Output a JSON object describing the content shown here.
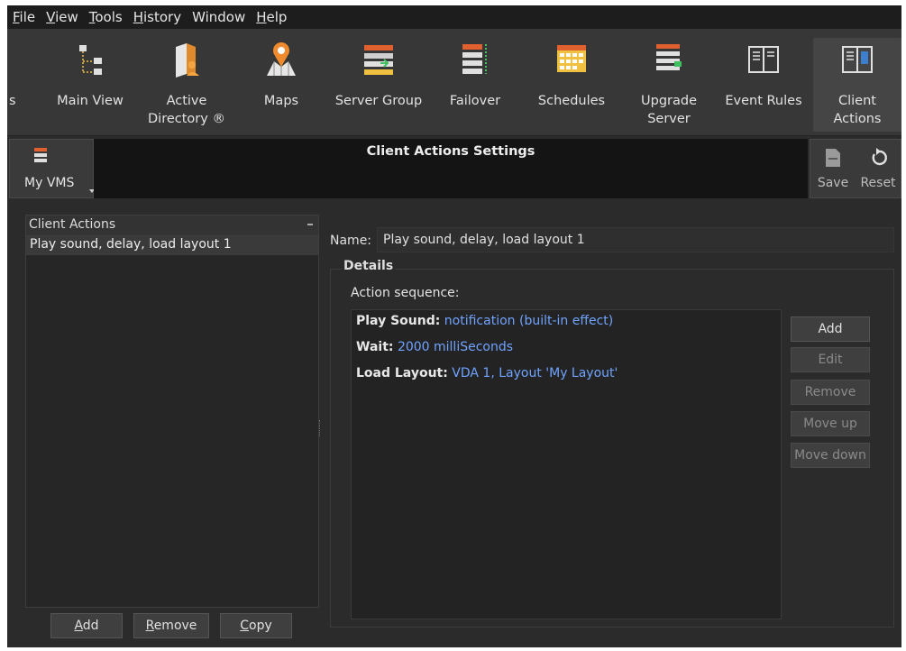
{
  "menu": [
    {
      "label": "File",
      "ul": "F",
      "rest": "ile"
    },
    {
      "label": "View",
      "ul": "V",
      "rest": "iew"
    },
    {
      "label": "Tools",
      "ul": "T",
      "rest": "ools"
    },
    {
      "label": "History",
      "ul": "H",
      "rest": "istory"
    },
    {
      "label": "Window",
      "ul": "",
      "rest": "Window"
    },
    {
      "label": "Help",
      "ul": "H",
      "rest": "elp"
    }
  ],
  "ribbon": {
    "partial": "s",
    "main_view": "Main View",
    "active_directory": [
      "Active",
      "Directory ®"
    ],
    "maps": "Maps",
    "server_group": "Server Group",
    "failover": "Failover",
    "schedules": "Schedules",
    "upgrade_server": [
      "Upgrade",
      "Server"
    ],
    "event_rules": "Event Rules",
    "client_actions": [
      "Client",
      "Actions"
    ]
  },
  "header": {
    "my_vms": "My VMS",
    "title": "Client Actions Settings",
    "save": "Save",
    "reset": "Reset"
  },
  "left_panel": {
    "header": "Client Actions",
    "items": [
      "Play sound, delay, load layout 1"
    ],
    "buttons": {
      "add": {
        "ul": "A",
        "rest": "dd"
      },
      "remove": {
        "ul": "R",
        "rest": "emove"
      },
      "copy": {
        "ul": "C",
        "rest": "opy"
      }
    }
  },
  "detail": {
    "name_label": "Name:",
    "name_value": "Play sound, delay, load layout 1",
    "group_title": "Details",
    "sequence_label": "Action sequence:",
    "sequence": [
      {
        "key": "Play Sound:",
        "value": "notification (built-in effect)"
      },
      {
        "key": "Wait:",
        "value": "2000 milliSeconds"
      },
      {
        "key": "Load Layout:",
        "value": "VDA 1, Layout 'My Layout'"
      }
    ],
    "buttons": {
      "add": "Add",
      "edit": "Edit",
      "remove": "Remove",
      "move_up": "Move up",
      "move_down": "Move down"
    }
  },
  "colors": {
    "accent_blue": "#6fa3ff",
    "panel_bg": "#2b2b2b",
    "title_bg": "#141414"
  }
}
